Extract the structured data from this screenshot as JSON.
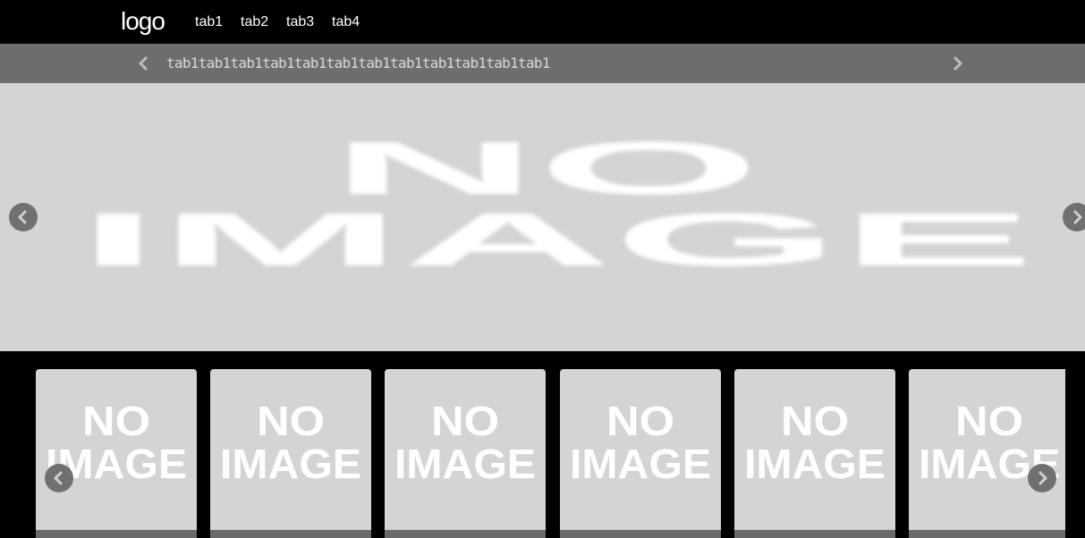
{
  "header": {
    "logo": "logo",
    "tabs": [
      "tab1",
      "tab2",
      "tab3",
      "tab4"
    ]
  },
  "subnav": {
    "text": "tab1tab1tab1tab1tab1tab1tab1tab1tab1tab1tab1tab1"
  },
  "hero": {
    "placeholder_line1": "NO",
    "placeholder_line2": "IMAGE"
  },
  "thumbnails": [
    {
      "line1": "NO",
      "line2": "IMAGE"
    },
    {
      "line1": "NO",
      "line2": "IMAGE"
    },
    {
      "line1": "NO",
      "line2": "IMAGE"
    },
    {
      "line1": "NO",
      "line2": "IMAGE"
    },
    {
      "line1": "NO",
      "line2": "IMAGE"
    },
    {
      "line1": "NO",
      "line2": "IMAGE"
    }
  ],
  "icons": {
    "subnav_prev": "chevron-left-icon",
    "subnav_next": "chevron-right-icon",
    "hero_prev": "chevron-left-icon",
    "hero_next": "chevron-right-icon",
    "thumbs_prev": "chevron-left-icon",
    "thumbs_next": "chevron-right-icon"
  },
  "colors": {
    "background": "#000000",
    "subnav_bg": "#6d6d6d",
    "placeholder_bg": "#d4d4d4",
    "arrow_button": "#707070"
  }
}
